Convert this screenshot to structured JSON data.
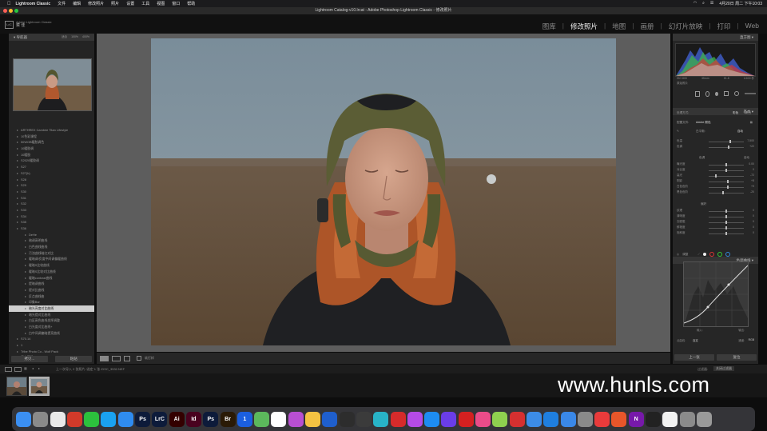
{
  "menubar": {
    "app": "Lightroom Classic",
    "items": [
      "文件",
      "编辑",
      "修改照片",
      "照片",
      "设置",
      "工具",
      "视图",
      "窗口",
      "帮助"
    ],
    "clock": "4月20日 周二 下午10:03"
  },
  "window": {
    "title": "Lightroom Catalog-v10.lrcat - Adobe Photoshop Lightroom Classic - 修改照片"
  },
  "identity": {
    "logo": "LrC",
    "line1": "Adobe Lightroom Classic",
    "line2": "菜 佳"
  },
  "modules": [
    {
      "label": "图库",
      "active": false
    },
    {
      "label": "修改照片",
      "active": true
    },
    {
      "label": "地图",
      "active": false
    },
    {
      "label": "画册",
      "active": false
    },
    {
      "label": "幻灯片放映",
      "active": false
    },
    {
      "label": "打印",
      "active": false
    },
    {
      "label": "Web",
      "active": false
    }
  ],
  "left": {
    "navigator_title": "导航器",
    "zoom_opts": [
      "适合",
      "100%",
      "400%"
    ],
    "presets": [
      {
        "label": "ARTHREX Cambrie Titan Lifestyle",
        "child": false
      },
      {
        "label": "10色彩课程",
        "child": false
      },
      {
        "label": "50WOB暖胶调色",
        "child": false
      },
      {
        "label": "10暖胶调",
        "child": false
      },
      {
        "label": "10暖胶",
        "child": false
      },
      {
        "label": "S2020暖胶调",
        "child": false
      },
      {
        "label": "S27",
        "child": false
      },
      {
        "label": "S27(b)",
        "child": false
      },
      {
        "label": "S28",
        "child": false
      },
      {
        "label": "S29",
        "child": false
      },
      {
        "label": "S30",
        "child": false
      },
      {
        "label": "S31",
        "child": false
      },
      {
        "label": "S32",
        "child": false
      },
      {
        "label": "S33",
        "child": false
      },
      {
        "label": "S34",
        "child": false
      },
      {
        "label": "S35",
        "child": false
      },
      {
        "label": "S36",
        "child": false
      },
      {
        "label": "DeHe",
        "child": true
      },
      {
        "label": "暗调高明曲线",
        "child": true
      },
      {
        "label": "白色曲线曲线",
        "child": true
      },
      {
        "label": "污浊曲线暗红对比",
        "child": true
      },
      {
        "label": "暖暗调/负度中间调偏暖曲线",
        "child": true
      },
      {
        "label": "暖暗S比较曲线",
        "child": true
      },
      {
        "label": "暖暗S比较对比曲线",
        "child": true
      },
      {
        "label": "暖暗contrast曲线",
        "child": true
      },
      {
        "label": "提暗调曲线",
        "child": true
      },
      {
        "label": "提对比曲线",
        "child": true
      },
      {
        "label": "反点曲线曲",
        "child": true
      },
      {
        "label": "印象Bar",
        "child": true
      },
      {
        "label": "暗光亮度对比曲线",
        "child": true,
        "selected": true
      },
      {
        "label": "暗光提对比曲线",
        "child": true
      },
      {
        "label": "白区高色曲线发挥调整",
        "child": true
      },
      {
        "label": "白光度对比曲线+",
        "child": true
      },
      {
        "label": "白中间调偏暗提亮曲线",
        "child": true
      },
      {
        "label": "S70.14",
        "child": false
      },
      {
        "label": "1",
        "child": false
      },
      {
        "label": "Tribe Photo Co - Wolf Pack",
        "child": false
      },
      {
        "label": "用户预设",
        "child": false
      }
    ],
    "copy_btn": "拷贝...",
    "paste_btn": "粘贴"
  },
  "toolbar": {
    "soft_proof": "软打样"
  },
  "right": {
    "histogram_title": "直方图",
    "readout": [
      "ISO 800",
      "35mm",
      "f/1.8",
      "1/400 秒"
    ],
    "orig_photo": "原始照片",
    "basic_title": "基本",
    "treatment_label": "处理方式:",
    "treatment_opts": [
      "彩色",
      "黑白"
    ],
    "profile_label": "配置文件:",
    "profile_value": "Adobe 颜色",
    "wb_label": "白平衡:",
    "wb_value": "自动",
    "sliders_wb": [
      {
        "label": "色温",
        "value": "7,500",
        "pos": 0.62
      },
      {
        "label": "色调",
        "value": "+22",
        "pos": 0.56
      }
    ],
    "tone_label": "色调",
    "tone_auto": "自动",
    "sliders_tone": [
      {
        "label": "曝光度",
        "value": "0.00",
        "pos": 0.5
      },
      {
        "label": "对比度",
        "value": "0",
        "pos": 0.5
      },
      {
        "label": "高光",
        "value": "-72",
        "pos": 0.2
      },
      {
        "label": "阴影",
        "value": "+8",
        "pos": 0.54
      },
      {
        "label": "白色色阶",
        "value": "+9",
        "pos": 0.55
      },
      {
        "label": "黑色色阶",
        "value": "-20",
        "pos": 0.4
      }
    ],
    "presence_label": "偏好",
    "sliders_presence": [
      {
        "label": "纹理",
        "value": "0",
        "pos": 0.5
      },
      {
        "label": "清晰度",
        "value": "0",
        "pos": 0.5
      },
      {
        "label": "去朦胧",
        "value": "0",
        "pos": 0.5
      },
      {
        "label": "鲜艳度",
        "value": "0",
        "pos": 0.5
      },
      {
        "label": "饱和度",
        "value": "0",
        "pos": 0.5
      }
    ],
    "curve_title": "色调曲线",
    "curve_adjust": "调整",
    "curve_labels": [
      "阴影",
      "暗色调",
      "亮色调",
      "高光"
    ],
    "curve_input": "输入:",
    "curve_output": "输出:",
    "channel_label": "通道:",
    "channel_value": "RGB",
    "point_label": "点曲线:",
    "point_value": "自定",
    "prev_btn": "上一张",
    "reset_btn": "复位"
  },
  "filmstrip": {
    "source": "上一次导入  2 张照片 /选定 1 张 /DSC_3532.NEF",
    "filter_label": "过滤器:",
    "filter_value": "关闭过滤器"
  },
  "dock": {
    "apps": [
      {
        "name": "finder",
        "label": "",
        "color": "#3b8ff2"
      },
      {
        "name": "launchpad",
        "label": "",
        "color": "#8a8a8a"
      },
      {
        "name": "chrome",
        "label": "",
        "color": "#e9e9e9"
      },
      {
        "name": "thunder",
        "label": "",
        "color": "#d23a2a"
      },
      {
        "name": "wechat",
        "label": "",
        "color": "#2cc13d"
      },
      {
        "name": "qq",
        "label": "",
        "color": "#1aa2f1"
      },
      {
        "name": "baidu-netdisk",
        "label": "",
        "color": "#2f8cf0"
      },
      {
        "name": "photoshop-2021",
        "label": "Ps",
        "color": "#0d1b3a"
      },
      {
        "name": "lightroom-classic",
        "label": "LrC",
        "color": "#0d1b3a"
      },
      {
        "name": "illustrator",
        "label": "Ai",
        "color": "#330000"
      },
      {
        "name": "indesign",
        "label": "Id",
        "color": "#49021f"
      },
      {
        "name": "photoshop",
        "label": "Ps",
        "color": "#0d1b3a"
      },
      {
        "name": "bridge",
        "label": "Br",
        "color": "#2a1a06"
      },
      {
        "name": "1password",
        "label": "1",
        "color": "#1b5fe0"
      },
      {
        "name": "maps",
        "label": "",
        "color": "#5cb85c"
      },
      {
        "name": "network",
        "label": "",
        "color": "#ffffff"
      },
      {
        "name": "trello",
        "label": "",
        "color": "#b84fd1"
      },
      {
        "name": "photos",
        "label": "",
        "color": "#f4c242"
      },
      {
        "name": "notes",
        "label": "",
        "color": "#1f5fce"
      },
      {
        "name": "premiere",
        "label": "",
        "color": "#2d2d2d"
      },
      {
        "name": "final-cut",
        "label": "",
        "color": "#3b3b3b"
      },
      {
        "name": "utorrent",
        "label": "",
        "color": "#28b3c7"
      },
      {
        "name": "netease",
        "label": "",
        "color": "#d62b2b"
      },
      {
        "name": "podcast",
        "label": "",
        "color": "#b54be6"
      },
      {
        "name": "app-store",
        "label": "",
        "color": "#1d8cf2"
      },
      {
        "name": "vpn",
        "label": "",
        "color": "#6a3de8"
      },
      {
        "name": "netease-music",
        "label": "",
        "color": "#d42020"
      },
      {
        "name": "itunes",
        "label": "",
        "color": "#ea4c89"
      },
      {
        "name": "wechat-work",
        "label": "",
        "color": "#8fd14f"
      },
      {
        "name": "screen-record",
        "label": "",
        "color": "#d63030"
      },
      {
        "name": "paw",
        "label": "",
        "color": "#3c8ce7"
      },
      {
        "name": "wps",
        "label": "",
        "color": "#1f7fe0"
      },
      {
        "name": "mail",
        "label": "",
        "color": "#3a88e8"
      },
      {
        "name": "system-prefs",
        "label": "",
        "color": "#8a8a8a"
      },
      {
        "name": "creative-cloud",
        "label": "",
        "color": "#e93b3b"
      },
      {
        "name": "figma",
        "label": "",
        "color": "#e8562a"
      },
      {
        "name": "onenote",
        "label": "N",
        "color": "#7719aa"
      },
      {
        "name": "terminal",
        "label": "",
        "color": "#222"
      },
      {
        "name": "textedit",
        "label": "",
        "color": "#f2f2f2"
      },
      {
        "name": "preview",
        "label": "",
        "color": "#8b8b8b"
      },
      {
        "name": "trash",
        "label": "",
        "color": "#9a9a9a"
      }
    ]
  },
  "watermark": "www.hunls.com"
}
